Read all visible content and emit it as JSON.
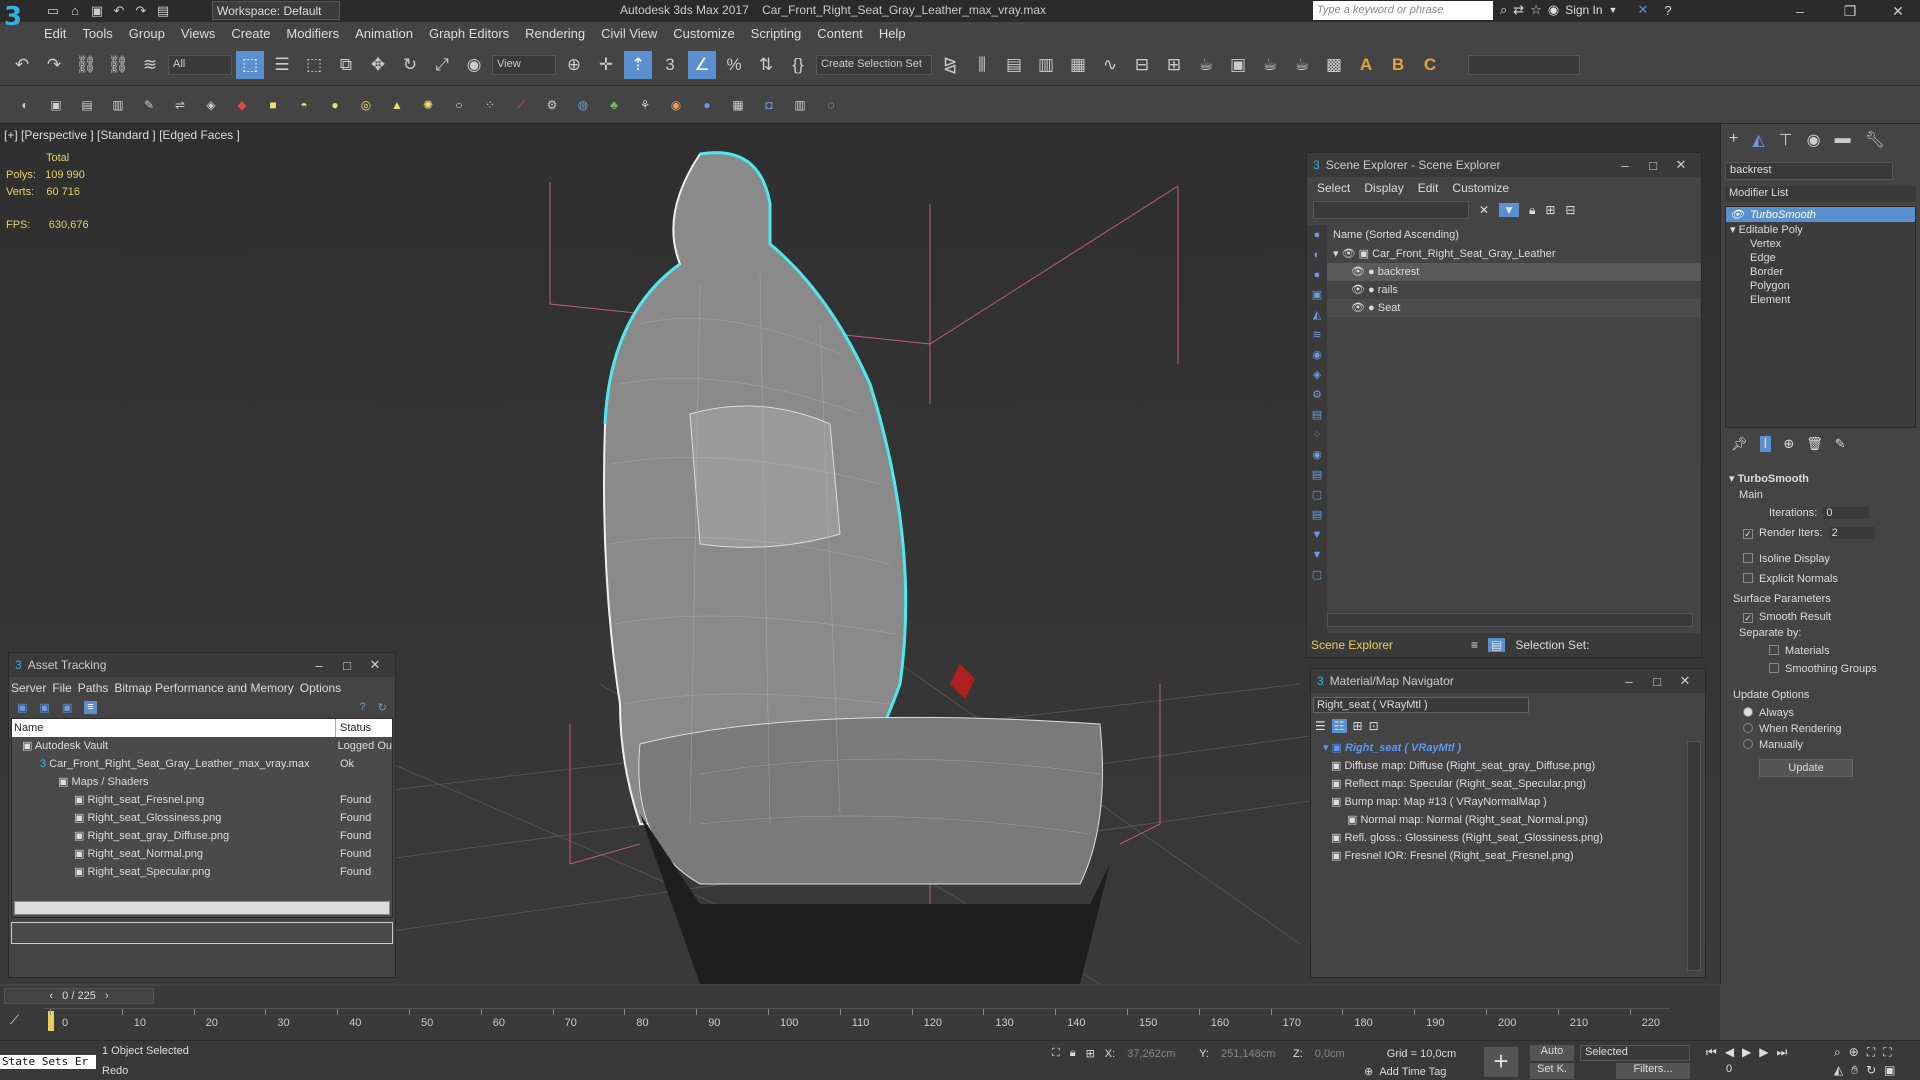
{
  "titlebar": {
    "logo": "3",
    "workspace": "Workspace: Default",
    "app_name": "Autodesk 3ds Max 2017",
    "file_name": "Car_Front_Right_Seat_Gray_Leather_max_vray.max",
    "search_placeholder": "Type a keyword or phrase",
    "sign_in": "Sign In"
  },
  "menu": [
    "Edit",
    "Tools",
    "Group",
    "Views",
    "Create",
    "Modifiers",
    "Animation",
    "Graph Editors",
    "Rendering",
    "Civil View",
    "Customize",
    "Scripting",
    "Content",
    "Help"
  ],
  "toolbar": {
    "filter": "All",
    "view": "View",
    "selection_set": "Create Selection Set"
  },
  "viewport": {
    "label": "[+] [Perspective ]  [Standard ]  [Edged Faces ]",
    "total": "Total",
    "polys_label": "Polys:",
    "polys": "109 990",
    "verts_label": "Verts:",
    "verts": "60 716",
    "fps_label": "FPS:",
    "fps": "630,676"
  },
  "scene_explorer": {
    "title": "Scene Explorer - Scene Explorer",
    "menu": [
      "Select",
      "Display",
      "Edit",
      "Customize"
    ],
    "column": "Name (Sorted Ascending)",
    "root": "Car_Front_Right_Seat_Gray_Leather",
    "items": [
      "backrest",
      "rails",
      "Seat"
    ],
    "footer_label": "Scene Explorer",
    "selection_set": "Selection Set:"
  },
  "material_nav": {
    "title": "Material/Map Navigator",
    "field": "Right_seat  ( VRayMtl )",
    "root": "Right_seat  ( VRayMtl )",
    "maps": [
      "Diffuse map: Diffuse (Right_seat_gray_Diffuse.png)",
      "Reflect map: Specular (Right_seat_Specular.png)",
      "Bump map: Map #13  ( VRayNormalMap )",
      "Normal map: Normal (Right_seat_Normal.png)",
      "Refl. gloss.: Glossiness (Right_seat_Glossiness.png)",
      "Fresnel IOR: Fresnel (Right_seat_Fresnel.png)"
    ]
  },
  "asset_tracking": {
    "title": "Asset Tracking",
    "menu": [
      "Server",
      "File",
      "Paths",
      "Bitmap Performance and Memory",
      "Options"
    ],
    "col_name": "Name",
    "col_status": "Status",
    "rows": [
      {
        "name": "Autodesk Vault",
        "status": "Logged Ou"
      },
      {
        "name": "Car_Front_Right_Seat_Gray_Leather_max_vray.max",
        "status": "Ok"
      },
      {
        "name": "Maps / Shaders",
        "status": ""
      },
      {
        "name": "Right_seat_Fresnel.png",
        "status": "Found"
      },
      {
        "name": "Right_seat_Glossiness.png",
        "status": "Found"
      },
      {
        "name": "Right_seat_gray_Diffuse.png",
        "status": "Found"
      },
      {
        "name": "Right_seat_Normal.png",
        "status": "Found"
      },
      {
        "name": "Right_seat_Specular.png",
        "status": "Found"
      }
    ]
  },
  "command_panel": {
    "object_name": "backrest",
    "modifier_list": "Modifier List",
    "stack": [
      "TurboSmooth",
      "Editable Poly",
      "Vertex",
      "Edge",
      "Border",
      "Polygon",
      "Element"
    ],
    "rollout": "TurboSmooth",
    "main": "Main",
    "iterations_label": "Iterations:",
    "iterations": "0",
    "render_iters_label": "Render Iters:",
    "render_iters": "2",
    "isoline": "Isoline Display",
    "explicit_normals": "Explicit Normals",
    "surface_params": "Surface Parameters",
    "smooth_result": "Smooth Result",
    "separate_by": "Separate by:",
    "materials": "Materials",
    "smoothing_groups": "Smoothing Groups",
    "update_options": "Update Options",
    "always": "Always",
    "when_rendering": "When Rendering",
    "manually": "Manually",
    "update": "Update"
  },
  "timeline": {
    "frame": "0 / 225",
    "ticks": [
      "0",
      "10",
      "20",
      "30",
      "40",
      "50",
      "60",
      "70",
      "80",
      "90",
      "100",
      "110",
      "120",
      "130",
      "140",
      "150",
      "160",
      "170",
      "180",
      "190",
      "200",
      "210",
      "220"
    ]
  },
  "status": {
    "state_sets": "State Sets Er",
    "selected": "1 Object Selected",
    "prompt": "Redo",
    "x_label": "X:",
    "x": "37,262cm",
    "y_label": "Y:",
    "y": "251,148cm",
    "z_label": "Z:",
    "z": "0,0cm",
    "grid": "Grid = 10,0cm",
    "add_time_tag": "Add Time Tag",
    "auto": "Auto",
    "selected_dd": "Selected",
    "set_k": "Set K.",
    "filters": "Filters...",
    "frame_field": "0"
  }
}
